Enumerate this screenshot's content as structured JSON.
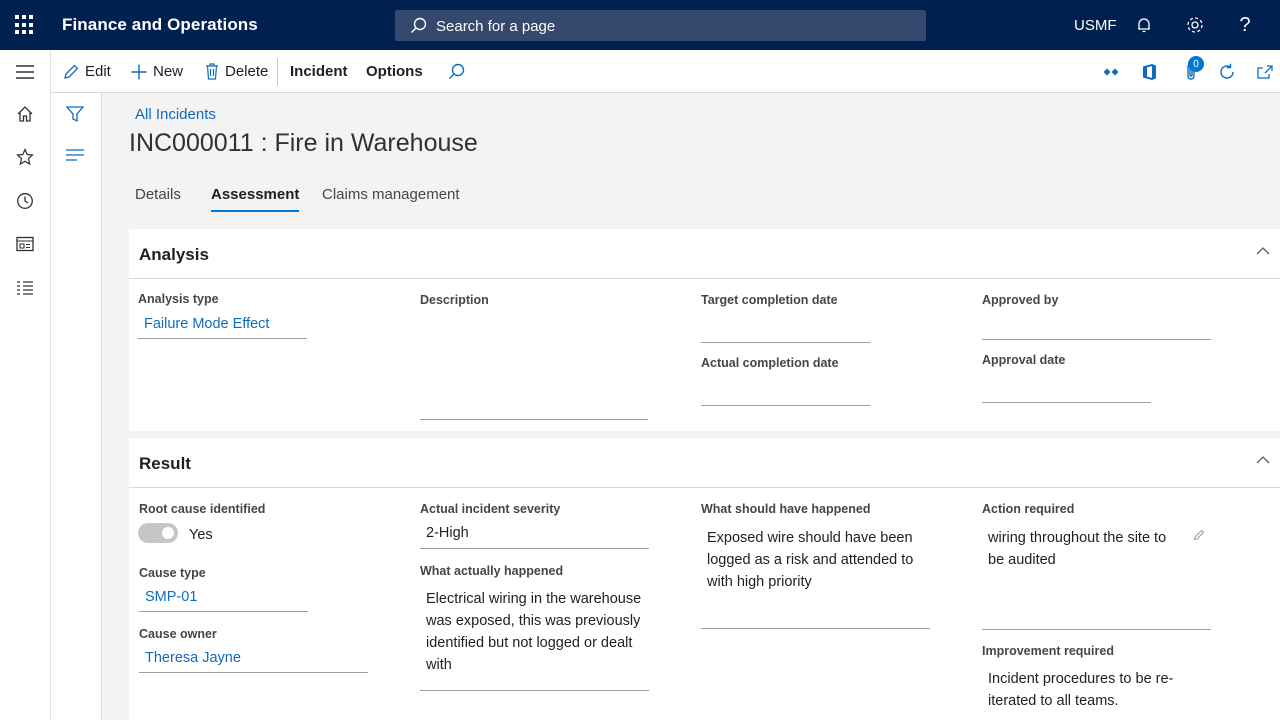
{
  "app": {
    "title": "Finance and Operations",
    "search_placeholder": "Search for a page",
    "company": "USMF"
  },
  "actions": {
    "edit": "Edit",
    "new": "New",
    "delete": "Delete",
    "incident": "Incident",
    "options": "Options",
    "attachments_count": "0"
  },
  "breadcrumb": "All Incidents",
  "page_title": "INC000011 : Fire in Warehouse",
  "tabs": [
    {
      "label": "Details",
      "active": false
    },
    {
      "label": "Assessment",
      "active": true
    },
    {
      "label": "Claims management",
      "active": false
    }
  ],
  "analysis": {
    "title": "Analysis",
    "analysis_type_label": "Analysis type",
    "analysis_type_value": "Failure Mode Effect",
    "description_label": "Description",
    "description_value": "",
    "target_completion_label": "Target completion date",
    "target_completion_value": "",
    "actual_completion_label": "Actual completion date",
    "actual_completion_value": "",
    "approved_by_label": "Approved by",
    "approved_by_value": "",
    "approval_date_label": "Approval date",
    "approval_date_value": ""
  },
  "result": {
    "title": "Result",
    "root_cause_label": "Root cause identified",
    "root_cause_value": "Yes",
    "cause_type_label": "Cause type",
    "cause_type_value": "SMP-01",
    "cause_owner_label": "Cause owner",
    "cause_owner_value": "Theresa Jayne",
    "severity_label": "Actual incident severity",
    "severity_value": "2-High",
    "what_happened_label": "What actually happened",
    "what_happened_value": "Electrical wiring in the warehouse was exposed, this was previously identified but not logged or dealt with",
    "should_have_label": "What should have happened",
    "should_have_value": "Exposed wire should have been logged as a risk and attended to with high priority",
    "action_required_label": "Action required",
    "action_required_value": "wiring throughout the site to be audited",
    "improvement_label": "Improvement required",
    "improvement_value": "Incident procedures to be re-iterated to all teams."
  }
}
